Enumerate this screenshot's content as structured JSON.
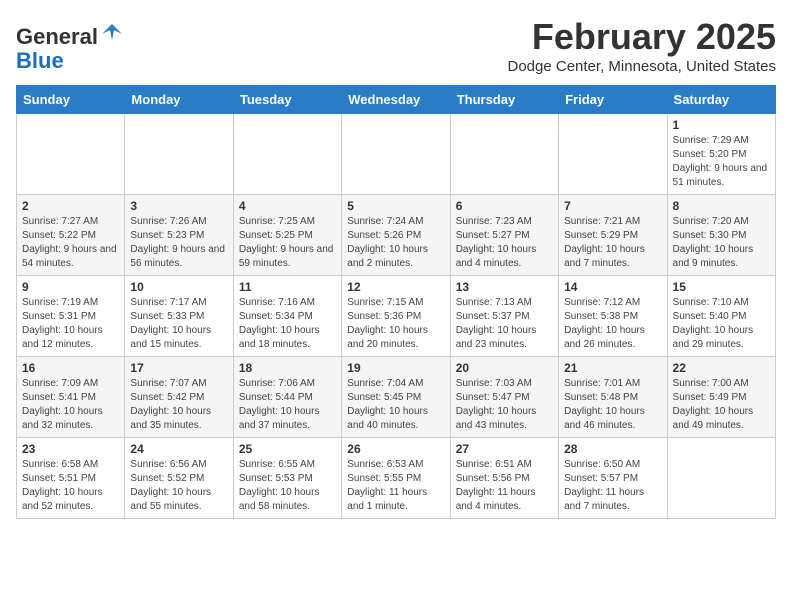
{
  "header": {
    "logo_general": "General",
    "logo_blue": "Blue",
    "month_title": "February 2025",
    "location": "Dodge Center, Minnesota, United States"
  },
  "days_of_week": [
    "Sunday",
    "Monday",
    "Tuesday",
    "Wednesday",
    "Thursday",
    "Friday",
    "Saturday"
  ],
  "weeks": [
    [
      {
        "day": "",
        "info": ""
      },
      {
        "day": "",
        "info": ""
      },
      {
        "day": "",
        "info": ""
      },
      {
        "day": "",
        "info": ""
      },
      {
        "day": "",
        "info": ""
      },
      {
        "day": "",
        "info": ""
      },
      {
        "day": "1",
        "info": "Sunrise: 7:29 AM\nSunset: 5:20 PM\nDaylight: 9 hours\nand 51 minutes."
      }
    ],
    [
      {
        "day": "2",
        "info": "Sunrise: 7:27 AM\nSunset: 5:22 PM\nDaylight: 9 hours\nand 54 minutes."
      },
      {
        "day": "3",
        "info": "Sunrise: 7:26 AM\nSunset: 5:23 PM\nDaylight: 9 hours\nand 56 minutes."
      },
      {
        "day": "4",
        "info": "Sunrise: 7:25 AM\nSunset: 5:25 PM\nDaylight: 9 hours\nand 59 minutes."
      },
      {
        "day": "5",
        "info": "Sunrise: 7:24 AM\nSunset: 5:26 PM\nDaylight: 10 hours\nand 2 minutes."
      },
      {
        "day": "6",
        "info": "Sunrise: 7:23 AM\nSunset: 5:27 PM\nDaylight: 10 hours\nand 4 minutes."
      },
      {
        "day": "7",
        "info": "Sunrise: 7:21 AM\nSunset: 5:29 PM\nDaylight: 10 hours\nand 7 minutes."
      },
      {
        "day": "8",
        "info": "Sunrise: 7:20 AM\nSunset: 5:30 PM\nDaylight: 10 hours\nand 9 minutes."
      }
    ],
    [
      {
        "day": "9",
        "info": "Sunrise: 7:19 AM\nSunset: 5:31 PM\nDaylight: 10 hours\nand 12 minutes."
      },
      {
        "day": "10",
        "info": "Sunrise: 7:17 AM\nSunset: 5:33 PM\nDaylight: 10 hours\nand 15 minutes."
      },
      {
        "day": "11",
        "info": "Sunrise: 7:16 AM\nSunset: 5:34 PM\nDaylight: 10 hours\nand 18 minutes."
      },
      {
        "day": "12",
        "info": "Sunrise: 7:15 AM\nSunset: 5:36 PM\nDaylight: 10 hours\nand 20 minutes."
      },
      {
        "day": "13",
        "info": "Sunrise: 7:13 AM\nSunset: 5:37 PM\nDaylight: 10 hours\nand 23 minutes."
      },
      {
        "day": "14",
        "info": "Sunrise: 7:12 AM\nSunset: 5:38 PM\nDaylight: 10 hours\nand 26 minutes."
      },
      {
        "day": "15",
        "info": "Sunrise: 7:10 AM\nSunset: 5:40 PM\nDaylight: 10 hours\nand 29 minutes."
      }
    ],
    [
      {
        "day": "16",
        "info": "Sunrise: 7:09 AM\nSunset: 5:41 PM\nDaylight: 10 hours\nand 32 minutes."
      },
      {
        "day": "17",
        "info": "Sunrise: 7:07 AM\nSunset: 5:42 PM\nDaylight: 10 hours\nand 35 minutes."
      },
      {
        "day": "18",
        "info": "Sunrise: 7:06 AM\nSunset: 5:44 PM\nDaylight: 10 hours\nand 37 minutes."
      },
      {
        "day": "19",
        "info": "Sunrise: 7:04 AM\nSunset: 5:45 PM\nDaylight: 10 hours\nand 40 minutes."
      },
      {
        "day": "20",
        "info": "Sunrise: 7:03 AM\nSunset: 5:47 PM\nDaylight: 10 hours\nand 43 minutes."
      },
      {
        "day": "21",
        "info": "Sunrise: 7:01 AM\nSunset: 5:48 PM\nDaylight: 10 hours\nand 46 minutes."
      },
      {
        "day": "22",
        "info": "Sunrise: 7:00 AM\nSunset: 5:49 PM\nDaylight: 10 hours\nand 49 minutes."
      }
    ],
    [
      {
        "day": "23",
        "info": "Sunrise: 6:58 AM\nSunset: 5:51 PM\nDaylight: 10 hours\nand 52 minutes."
      },
      {
        "day": "24",
        "info": "Sunrise: 6:56 AM\nSunset: 5:52 PM\nDaylight: 10 hours\nand 55 minutes."
      },
      {
        "day": "25",
        "info": "Sunrise: 6:55 AM\nSunset: 5:53 PM\nDaylight: 10 hours\nand 58 minutes."
      },
      {
        "day": "26",
        "info": "Sunrise: 6:53 AM\nSunset: 5:55 PM\nDaylight: 11 hours\nand 1 minute."
      },
      {
        "day": "27",
        "info": "Sunrise: 6:51 AM\nSunset: 5:56 PM\nDaylight: 11 hours\nand 4 minutes."
      },
      {
        "day": "28",
        "info": "Sunrise: 6:50 AM\nSunset: 5:57 PM\nDaylight: 11 hours\nand 7 minutes."
      },
      {
        "day": "",
        "info": ""
      }
    ]
  ]
}
